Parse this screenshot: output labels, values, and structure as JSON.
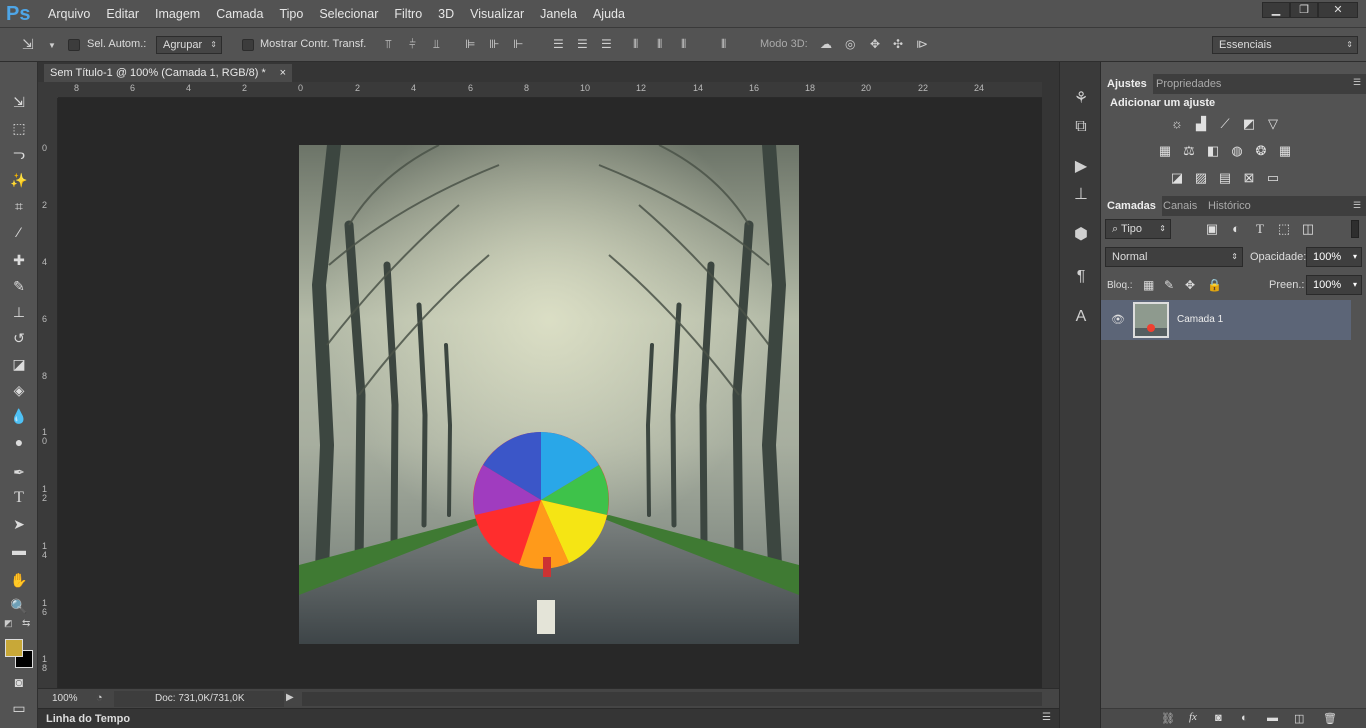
{
  "app": {
    "logo": "Ps"
  },
  "menu": [
    "Arquivo",
    "Editar",
    "Imagem",
    "Camada",
    "Tipo",
    "Selecionar",
    "Filtro",
    "3D",
    "Visualizar",
    "Janela",
    "Ajuda"
  ],
  "window_controls": {
    "minimize": "▁",
    "restore": "❐",
    "close": "✕"
  },
  "options": {
    "auto_select_label": "Sel. Autom.:",
    "auto_select_value": "Agrupar",
    "show_transform_label": "Mostrar Contr. Transf.",
    "mode3d_label": "Modo 3D:",
    "workspace": "Essenciais"
  },
  "document": {
    "tab_title": "Sem Título-1 @ 100% (Camada 1, RGB/8) *",
    "close": "×"
  },
  "ruler": {
    "top": [
      "8",
      "6",
      "4",
      "2",
      "0",
      "2",
      "4",
      "6",
      "8",
      "10",
      "12",
      "14",
      "16",
      "18",
      "20",
      "22",
      "24"
    ],
    "left": [
      "0",
      "2",
      "4",
      "6",
      "8",
      "1 0",
      "1 2",
      "1 4",
      "1 6",
      "1 8"
    ]
  },
  "status": {
    "zoom": "100%",
    "doc_info": "Doc: 731,0K/731,0K"
  },
  "timeline": {
    "label": "Linha do Tempo"
  },
  "panels": {
    "adjustments_tab": "Ajustes",
    "properties_tab": "Propriedades",
    "adjust_heading": "Adicionar um ajuste",
    "layers_tab": "Camadas",
    "channels_tab": "Canais",
    "history_tab": "Histórico",
    "filter_kind": "Tipo",
    "blend_mode": "Normal",
    "opacity_label": "Opacidade:",
    "opacity_value": "100%",
    "lock_label": "Bloq.:",
    "fill_label": "Preen.:",
    "fill_value": "100%",
    "layer_name": "Camada 1"
  },
  "colors": {
    "foreground": "#c8a838",
    "background": "#000000",
    "selection": "#5c6577"
  }
}
